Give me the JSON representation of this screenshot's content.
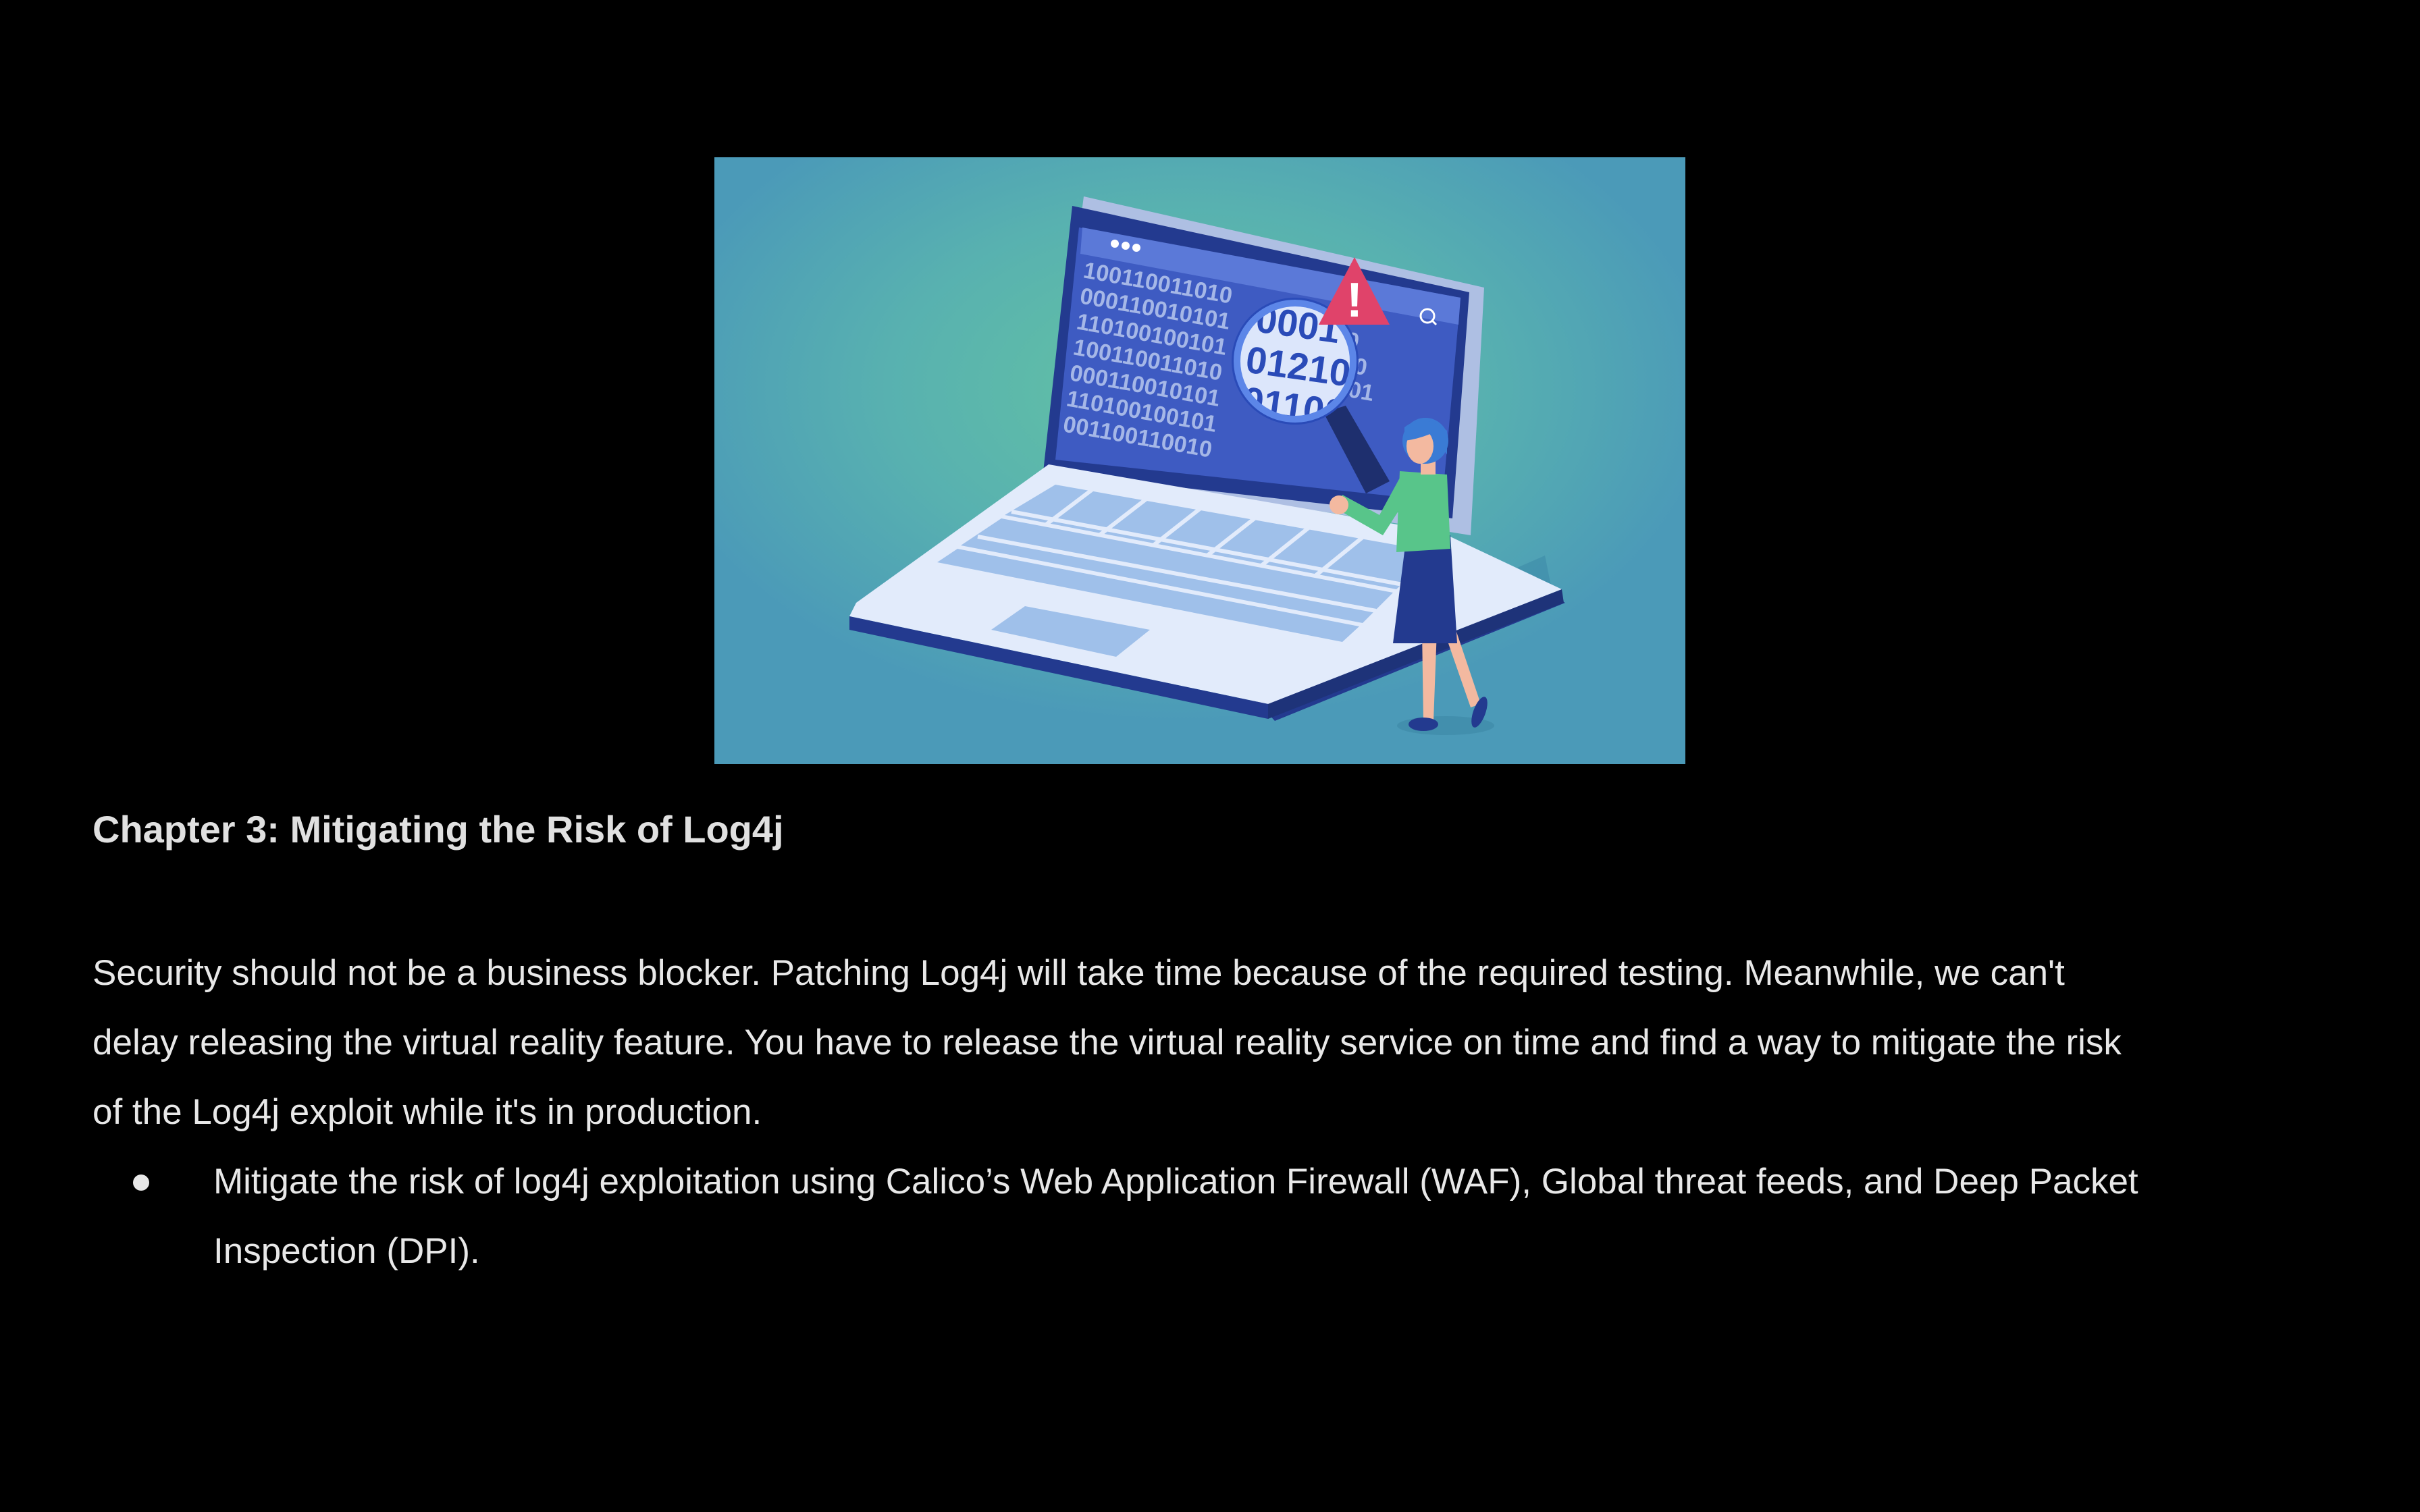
{
  "hero_image": {
    "icon": "laptop-security-illustration",
    "background_color": "#4b9ab8",
    "glow_color": "#63c3a3",
    "screen_binary_rows": [
      "100110011010",
      "000110010101",
      "110100100101",
      "100110011010",
      "000110010101",
      "110100100101",
      "001100110010"
    ],
    "magnifier_rows": [
      "0001",
      "01210",
      "01100"
    ],
    "alert_symbol": "!"
  },
  "chapter": {
    "title": "Chapter 3: Mitigating the Risk of Log4j"
  },
  "paragraph": {
    "lines": [
      "Security should not be a business blocker. Patching Log4j will take time because of the required testing. Meanwhile, we can't",
      "delay releasing the virtual reality feature. You have to release the virtual reality service on time and find a way to mitigate the risk",
      "of the Log4j exploit while it's in production."
    ]
  },
  "bullets": [
    {
      "lines": [
        "Mitigate the risk of log4j exploitation using Calico’s Web Application Firewall (WAF), Global threat feeds, and Deep Packet",
        "Inspection (DPI)."
      ]
    }
  ]
}
